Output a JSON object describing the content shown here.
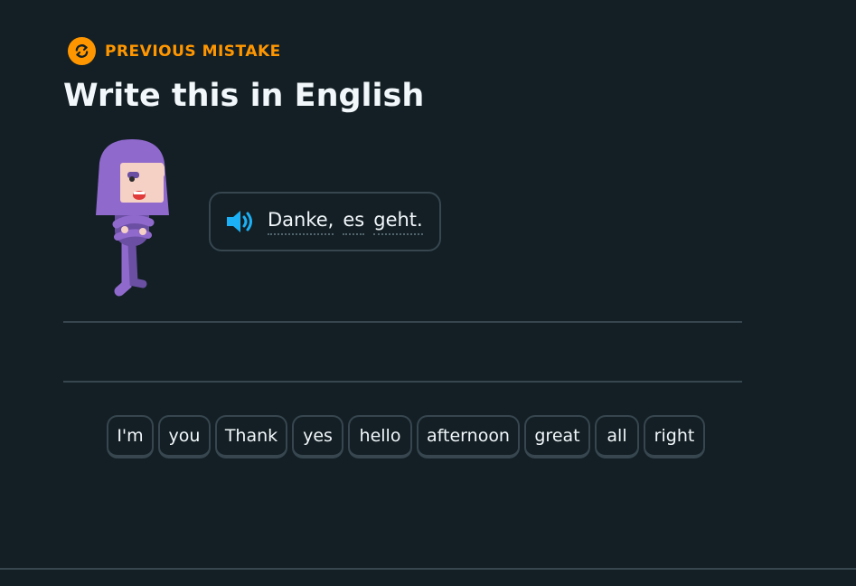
{
  "header": {
    "badge_icon": "repeat-arrows-icon",
    "badge_label": "PREVIOUS MISTAKE",
    "accent_color": "#ff9600"
  },
  "title": "Write this in English",
  "prompt": {
    "speaker_icon": "speaker-icon",
    "words": [
      "Danke,",
      "es",
      "geht."
    ]
  },
  "word_bank": [
    "I'm",
    "you",
    "Thank",
    "yes",
    "hello",
    "afternoon",
    "great",
    "all",
    "right"
  ],
  "colors": {
    "background": "#131f24",
    "border": "#37464f",
    "text": "#f1f7fb",
    "speaker": "#1cb0f6",
    "character_hair": "#9069cd"
  }
}
